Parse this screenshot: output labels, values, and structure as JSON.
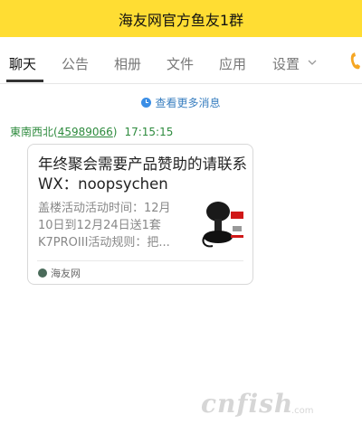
{
  "window": {
    "title": "海友网官方鱼友1群"
  },
  "tabs": [
    {
      "label": "聊天",
      "active": true
    },
    {
      "label": "公告"
    },
    {
      "label": "相册"
    },
    {
      "label": "文件"
    },
    {
      "label": "应用"
    },
    {
      "label": "设置"
    }
  ],
  "history": {
    "label": "查看更多消息"
  },
  "message": {
    "sender_name": "東南西北",
    "qq_number": "45989066",
    "time": "17:15:15",
    "card": {
      "title": "年终聚会需要产品赞助的请联系WX：noopsychen",
      "description": "盖楼活动活动时间：12月10日到12月24日送1套K7PROIII活动规则：把...",
      "source": "海友网"
    }
  },
  "watermark": {
    "text": "cnfish",
    "sub": ".com"
  },
  "colors": {
    "titlebar": "#ffdd33",
    "link": "#3a7fc0",
    "sender": "#2e8b3e"
  },
  "icons": {
    "history": "clock-icon",
    "phone": "phone-icon",
    "dropdown": "chevron-down-icon"
  }
}
